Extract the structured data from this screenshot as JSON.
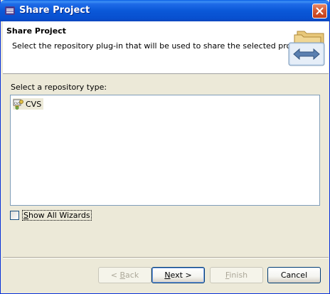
{
  "window": {
    "title": "Share Project",
    "close_icon": "close-icon",
    "app_icon": "eclipse-icon"
  },
  "banner": {
    "title": "Share Project",
    "description": "Select the repository plug-in that will be used to share the selected project.",
    "image_icon": "share-folders-icon"
  },
  "repository": {
    "label": "Select a repository type:",
    "items": [
      {
        "label": "CVS",
        "icon": "cvs-icon",
        "selected": true
      }
    ]
  },
  "show_all": {
    "label_prefix": "S",
    "label_rest": "how All Wizards",
    "checked": false
  },
  "buttons": {
    "back_prefix": "< ",
    "back_underlined": "B",
    "back_rest": "ack",
    "next_underlined": "N",
    "next_rest": "ext >",
    "finish_underlined": "F",
    "finish_rest": "inish",
    "cancel": "Cancel"
  },
  "colors": {
    "titlebar": "#0a58d8",
    "dialog_bg": "#ece9d8",
    "disabled_text": "#aca899"
  }
}
